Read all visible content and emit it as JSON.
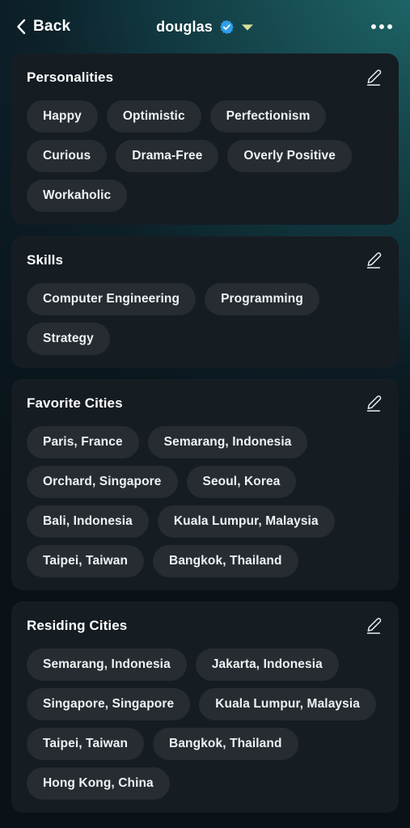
{
  "header": {
    "back_label": "Back",
    "back_icon": "chevron-left-icon",
    "title": "douglas",
    "verified_icon": "verified-badge-icon",
    "caret_icon": "chevron-down-icon",
    "more_icon": "more-horizontal-icon",
    "accent_verified_color": "#2f9eeb",
    "accent_caret_color": "#d7dd9a"
  },
  "theme": {
    "card_bg": "#151c22",
    "pill_bg": "#262c31",
    "text": "#ffffff"
  },
  "sections": [
    {
      "title": "Personalities",
      "edit_icon": "pencil-edit-icon",
      "tags": [
        "Happy",
        "Optimistic",
        "Perfectionism",
        "Curious",
        "Drama-Free",
        "Overly Positive",
        "Workaholic"
      ]
    },
    {
      "title": "Skills",
      "edit_icon": "pencil-edit-icon",
      "tags": [
        "Computer Engineering",
        "Programming",
        "Strategy"
      ]
    },
    {
      "title": "Favorite Cities",
      "edit_icon": "pencil-edit-icon",
      "tags": [
        "Paris, France",
        "Semarang, Indonesia",
        "Orchard, Singapore",
        "Seoul, Korea",
        "Bali, Indonesia",
        "Kuala Lumpur, Malaysia",
        "Taipei, Taiwan",
        "Bangkok, Thailand"
      ]
    },
    {
      "title": "Residing Cities",
      "edit_icon": "pencil-edit-icon",
      "tags": [
        "Semarang, Indonesia",
        "Jakarta, Indonesia",
        "Singapore, Singapore",
        "Kuala Lumpur, Malaysia",
        "Taipei, Taiwan",
        "Bangkok, Thailand",
        "Hong Kong, China"
      ]
    }
  ]
}
